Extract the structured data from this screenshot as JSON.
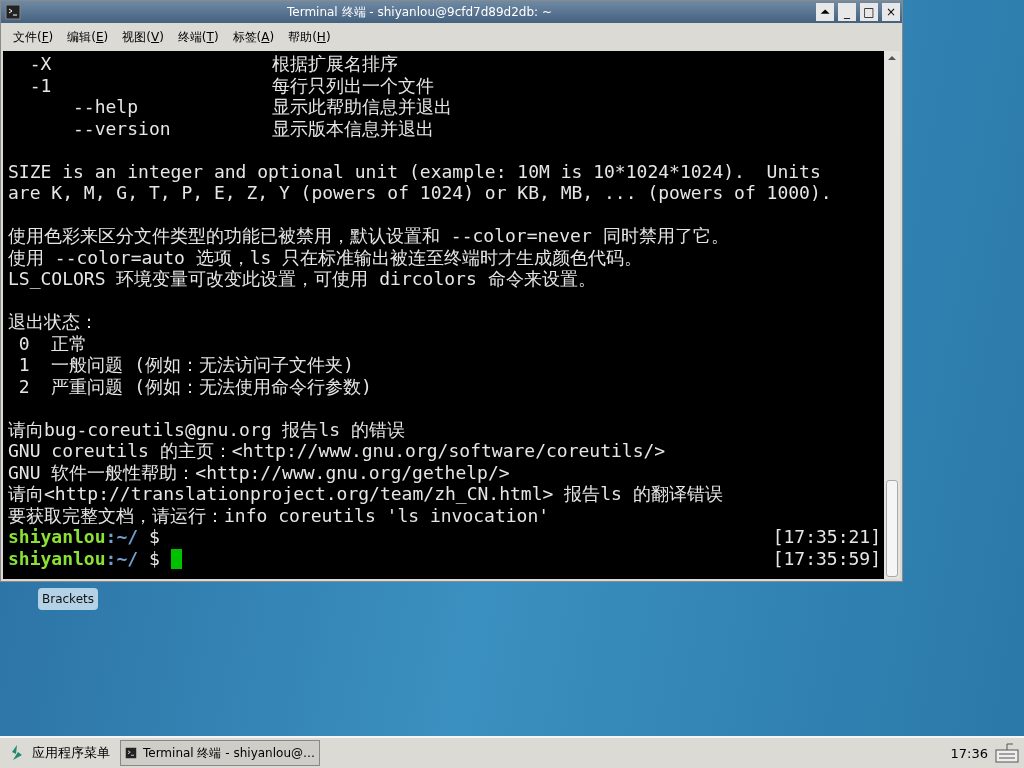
{
  "window": {
    "title": "Terminal 终端 - shiyanlou@9cfd7d89d2db: ~",
    "controls": [
      "⏶",
      "_",
      "□",
      "×"
    ]
  },
  "menu": [
    {
      "label": "文件(",
      "key": "F",
      "close": ")"
    },
    {
      "label": "编辑(",
      "key": "E",
      "close": ")"
    },
    {
      "label": "视图(",
      "key": "V",
      "close": ")"
    },
    {
      "label": "终端(",
      "key": "T",
      "close": ")"
    },
    {
      "label": "标签(",
      "key": "A",
      "close": ")"
    },
    {
      "label": "帮助(",
      "key": "H",
      "close": ")"
    }
  ],
  "terminal": {
    "lines": [
      {
        "kind": "option",
        "flag": "  -X",
        "text": "根据扩展名排序"
      },
      {
        "kind": "option",
        "flag": "  -1",
        "text": "每行只列出一个文件"
      },
      {
        "kind": "option",
        "flag": "      --help",
        "text": "显示此帮助信息并退出"
      },
      {
        "kind": "option",
        "flag": "      --version",
        "text": "显示版本信息并退出"
      },
      {
        "kind": "blank"
      },
      {
        "kind": "text",
        "text": "SIZE is an integer and optional unit (example: 10M is 10*1024*1024).  Units"
      },
      {
        "kind": "text",
        "text": "are K, M, G, T, P, E, Z, Y (powers of 1024) or KB, MB, ... (powers of 1000)."
      },
      {
        "kind": "blank"
      },
      {
        "kind": "text",
        "text": "使用色彩来区分文件类型的功能已被禁用，默认设置和 --color=never 同时禁用了它。"
      },
      {
        "kind": "text",
        "text": "使用 --color=auto 选项，ls 只在标准输出被连至终端时才生成颜色代码。"
      },
      {
        "kind": "text",
        "text": "LS_COLORS 环境变量可改变此设置，可使用 dircolors 命令来设置。"
      },
      {
        "kind": "blank"
      },
      {
        "kind": "text",
        "text": "退出状态："
      },
      {
        "kind": "text",
        "text": " 0  正常"
      },
      {
        "kind": "text",
        "text": " 1  一般问题 (例如：无法访问子文件夹)"
      },
      {
        "kind": "text",
        "text": " 2  严重问题 (例如：无法使用命令行参数)"
      },
      {
        "kind": "blank"
      },
      {
        "kind": "text",
        "text": "请向bug-coreutils@gnu.org 报告ls 的错误"
      },
      {
        "kind": "text",
        "text": "GNU coreutils 的主页：<http://www.gnu.org/software/coreutils/>"
      },
      {
        "kind": "text",
        "text": "GNU 软件一般性帮助：<http://www.gnu.org/gethelp/>"
      },
      {
        "kind": "text",
        "text": "请向<http://translationproject.org/team/zh_CN.html> 报告ls 的翻译错误"
      },
      {
        "kind": "text",
        "text": "要获取完整文档，请运行：info coreutils 'ls invocation'"
      },
      {
        "kind": "prompt",
        "user": "shiyanlou",
        "path": ":~/",
        "symbol": "$",
        "time": "[17:35:21]",
        "cursor": false
      },
      {
        "kind": "prompt",
        "user": "shiyanlou",
        "path": ":~/",
        "symbol": "$",
        "time": "[17:35:59]",
        "cursor": true
      }
    ]
  },
  "desktop": {
    "icons": [
      {
        "label": "Brackets"
      }
    ]
  },
  "taskbar": {
    "app_menu": "应用程序菜单",
    "tasks": [
      {
        "label": "Terminal 终端 - shiyanlou@…",
        "selected": true
      }
    ],
    "clock": "17:36"
  }
}
